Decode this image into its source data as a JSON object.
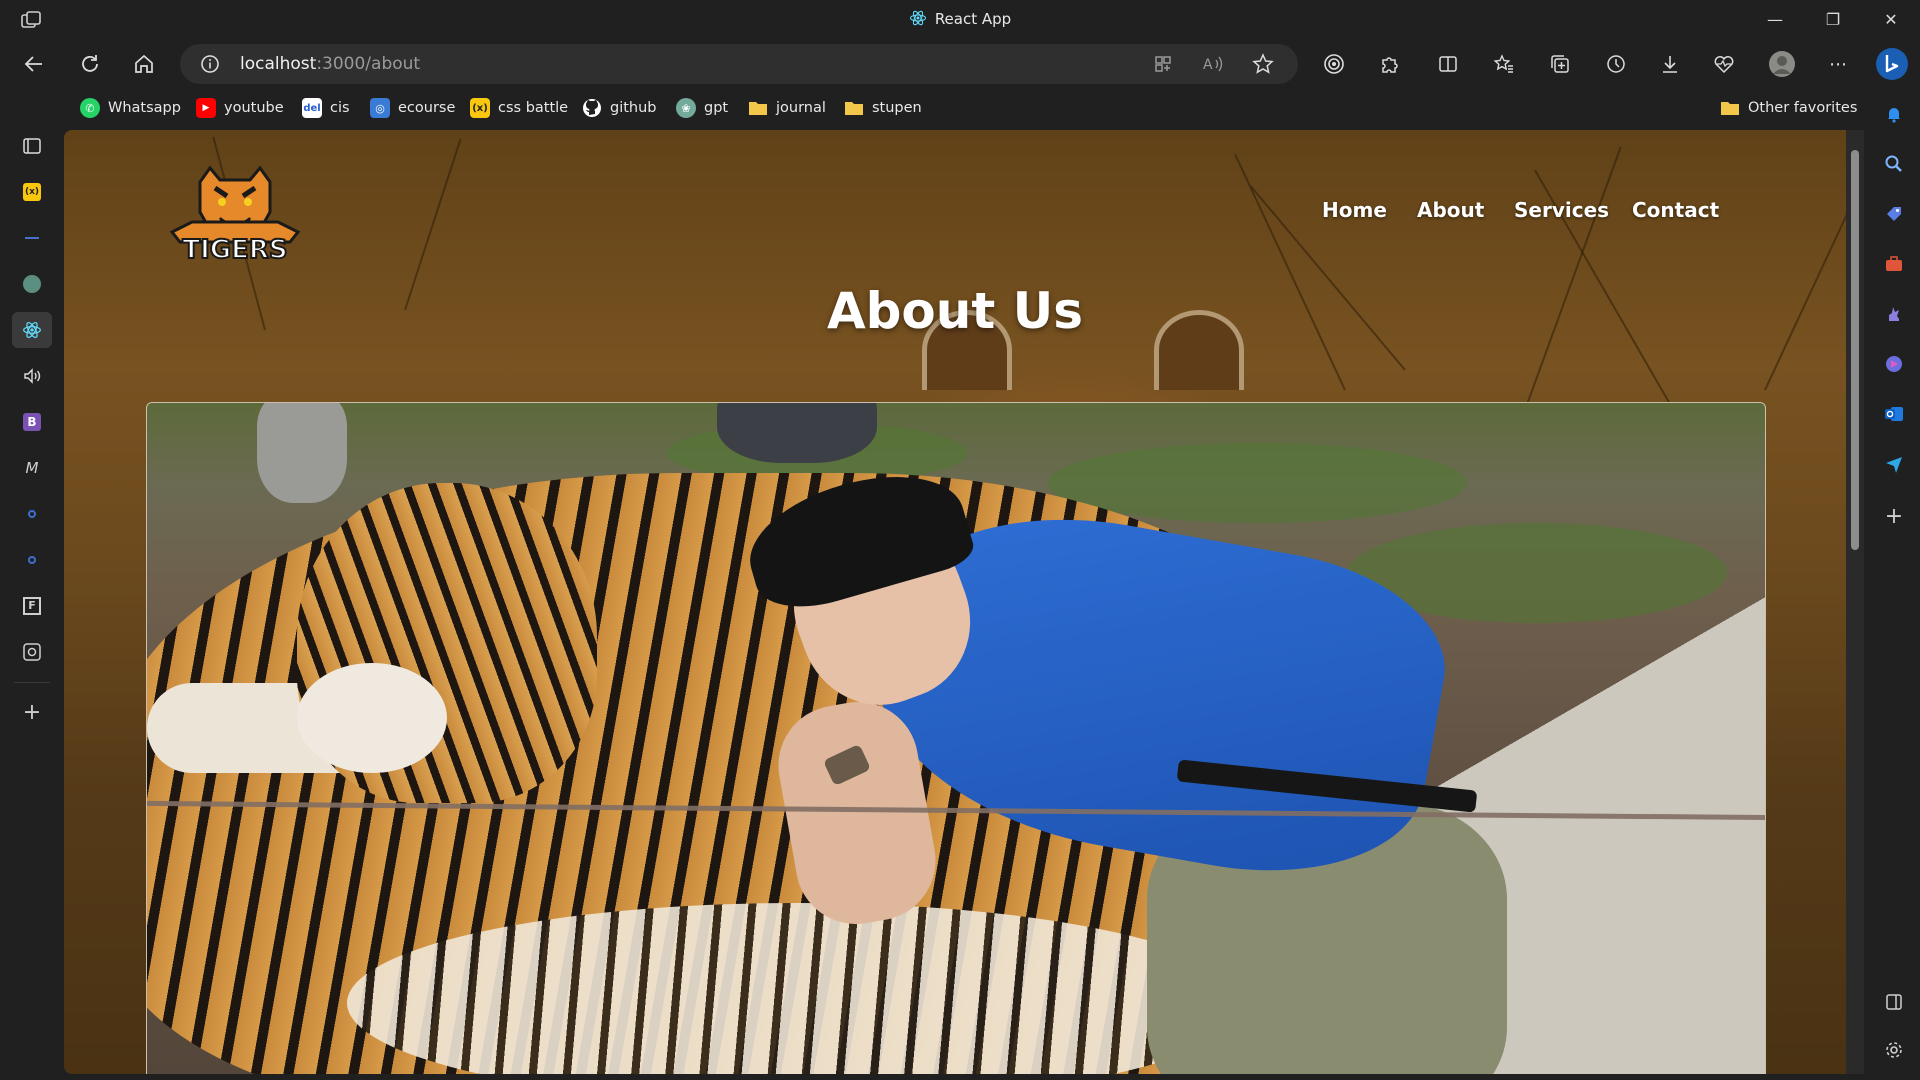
{
  "browser": {
    "tab_title": "React App",
    "url_host": "localhost",
    "url_path": ":3000/about",
    "window_controls": {
      "minimize": "—",
      "maximize": "❐",
      "close": "✕"
    }
  },
  "favorites": [
    {
      "label": "Whatsapp",
      "icon": "whatsapp-icon",
      "color": "#25d366"
    },
    {
      "label": "youtube",
      "icon": "youtube-icon",
      "color": "#ff0000"
    },
    {
      "label": "cis",
      "icon": "cis-icon",
      "color": "#2a5fd0"
    },
    {
      "label": "ecourse",
      "icon": "ecourse-icon",
      "color": "#3a7bd5"
    },
    {
      "label": "css battle",
      "icon": "cssbattle-icon",
      "color": "#f9c80e"
    },
    {
      "label": "github",
      "icon": "github-icon",
      "color": "#ffffff"
    },
    {
      "label": "gpt",
      "icon": "gpt-icon",
      "color": "#74aa9c"
    },
    {
      "label": "journal",
      "icon": "folder-icon",
      "color": "#f3c74a"
    },
    {
      "label": "stupen",
      "icon": "folder-icon",
      "color": "#f3c74a"
    }
  ],
  "other_favorites": "Other favorites",
  "site": {
    "logo_text": "TIGERS",
    "nav": [
      "Home",
      "About",
      "Services",
      "Contact"
    ],
    "page_title": "About Us"
  }
}
